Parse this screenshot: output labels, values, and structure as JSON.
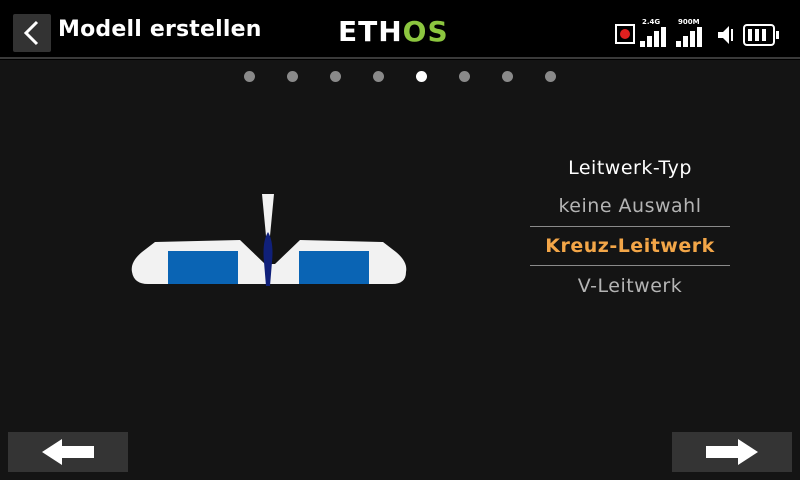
{
  "header": {
    "title": "Modell erstellen",
    "logo_left": "ETH",
    "logo_right": "OS",
    "logo_accent_color": "#8cc63f",
    "signal_1_label": "2.4G",
    "signal_2_label": "900M"
  },
  "wizard": {
    "total_steps": 8,
    "current_step": 5
  },
  "tail_type": {
    "heading": "Leitwerk-Typ",
    "options": [
      {
        "label": "keine Auswahl",
        "selected": false
      },
      {
        "label": "Kreuz-Leitwerk",
        "selected": true
      },
      {
        "label": "V-Leitwerk",
        "selected": false
      }
    ]
  },
  "colors": {
    "selected_text": "#f3a648",
    "wing_fill": "#f0f0f0",
    "control_surface": "#0a64b4",
    "rudder": "#10207a",
    "record": "#e0201f"
  },
  "icons": {
    "back": "chevron-left-icon",
    "prev": "arrow-left-icon",
    "next": "arrow-right-icon"
  }
}
